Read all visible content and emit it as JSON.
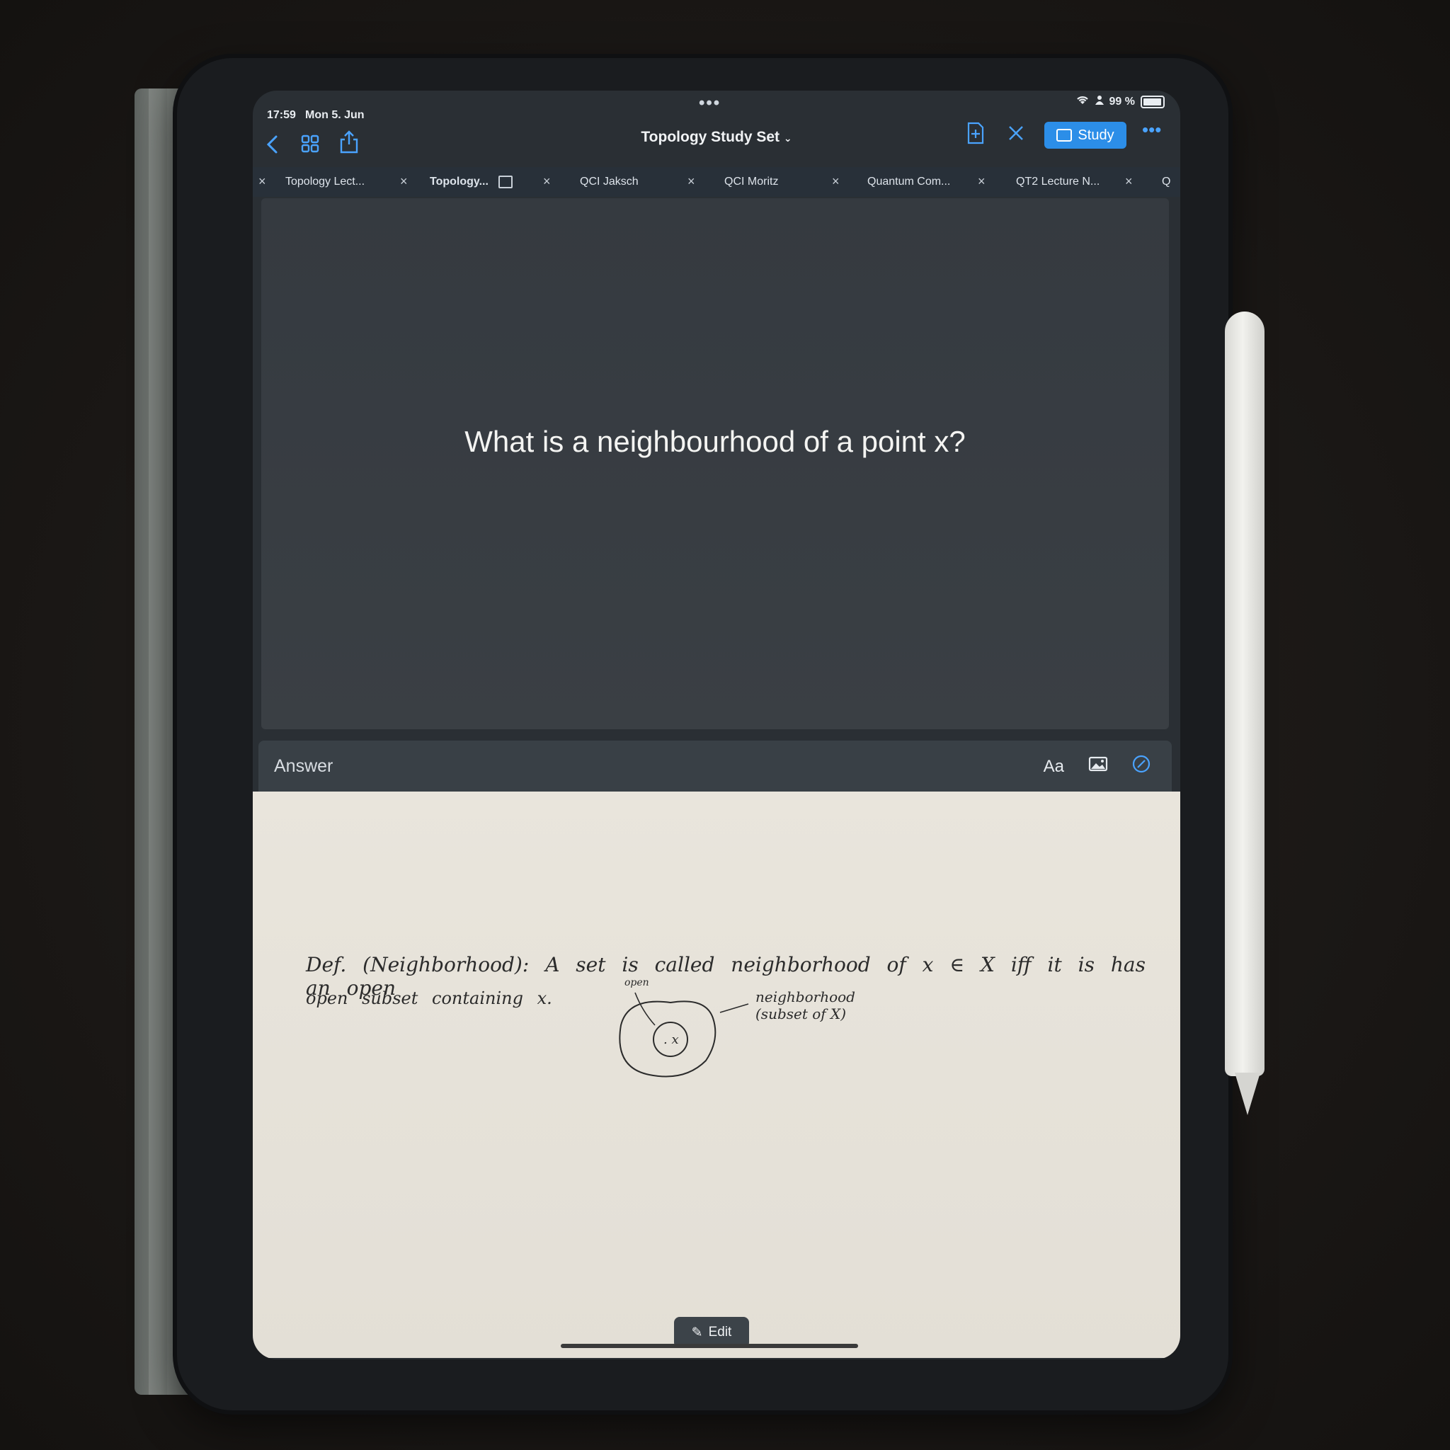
{
  "status_bar": {
    "time": "17:59",
    "date": "Mon 5. Jun",
    "battery": "99 %"
  },
  "toolbar": {
    "title": "Topology Study Set",
    "study_label": "Study",
    "icons": [
      "chevron-left-icon",
      "grid-icon",
      "share-icon",
      "add-page-icon",
      "pen-off-icon",
      "more-icon"
    ]
  },
  "tabs": [
    {
      "label": "Topology Lect..."
    },
    {
      "label": "Topology..."
    },
    {
      "label": "QCI Jaksch"
    },
    {
      "label": "QCI Moritz"
    },
    {
      "label": "Quantum Com..."
    },
    {
      "label": "QT2 Lecture N..."
    },
    {
      "label": "Q"
    }
  ],
  "card": {
    "question": "What is a neighbourhood of a point x?"
  },
  "answer": {
    "label": "Answer",
    "text_tool": "Aa",
    "handwriting_line1": "Def. (Neighborhood): A set is called neighborhood of x ∈ X iff it is has an open",
    "handwriting_line2": "open subset containing x.",
    "sketch_open": "open",
    "sketch_point": ". x",
    "sketch_neigh": "neighborhood",
    "sketch_subset": "(subset of X)",
    "edit_label": "Edit"
  },
  "colors": {
    "accent": "#2c8ee8",
    "screen_bg": "#2a2f34",
    "paper": "#e6e2d9"
  }
}
